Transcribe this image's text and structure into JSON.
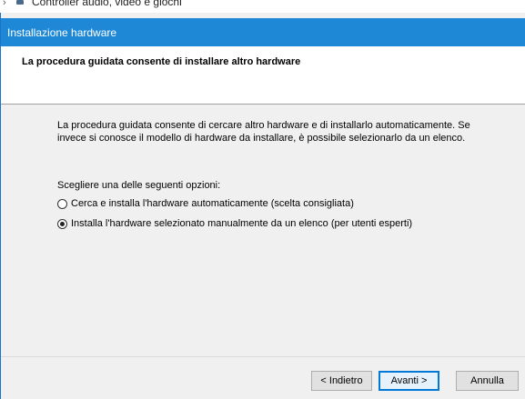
{
  "background_tree": {
    "chevron": "›",
    "item_icon": "device-icon",
    "item_label": "Controller audio, video e giochi"
  },
  "dialog": {
    "title": "Installazione hardware",
    "header_title": "La procedura guidata consente di installare altro hardware",
    "description_line1": "La procedura guidata consente di cercare altro hardware e di installarlo automaticamente. Se",
    "description_line2": "invece si conosce il modello di hardware da installare, è possibile selezionarlo da un elenco.",
    "options_label": "Scegliere una delle seguenti opzioni:",
    "options": [
      {
        "label": "Cerca e installa l'hardware automaticamente (scelta consigliata)",
        "selected": false
      },
      {
        "label": "Installa l'hardware selezionato manualmente da un elenco (per utenti esperti)",
        "selected": true
      }
    ],
    "buttons": {
      "back": "< Indietro",
      "next": "Avanti >",
      "cancel": "Annulla"
    }
  },
  "colors": {
    "titlebar": "#1e88d6",
    "dialog_bg": "#f0f0f0",
    "header_bg": "#ffffff",
    "default_button_border": "#0078d7"
  }
}
